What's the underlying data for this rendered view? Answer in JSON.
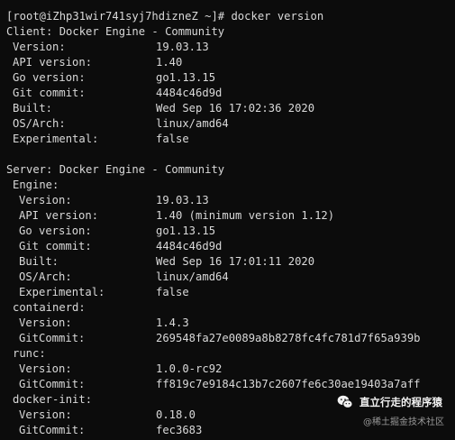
{
  "prompt": "[root@iZhp31wir741syj7hdizneZ ~]# docker version",
  "client": {
    "heading": "Client: Docker Engine - Community",
    "rows": [
      {
        "label": "Version:",
        "value": "19.03.13"
      },
      {
        "label": "API version:",
        "value": "1.40"
      },
      {
        "label": "Go version:",
        "value": "go1.13.15"
      },
      {
        "label": "Git commit:",
        "value": "4484c46d9d"
      },
      {
        "label": "Built:",
        "value": "Wed Sep 16 17:02:36 2020"
      },
      {
        "label": "OS/Arch:",
        "value": "linux/amd64"
      },
      {
        "label": "Experimental:",
        "value": "false"
      }
    ]
  },
  "server": {
    "heading": "Server: Docker Engine - Community",
    "engine": {
      "heading": "Engine:",
      "rows": [
        {
          "label": "Version:",
          "value": "19.03.13"
        },
        {
          "label": "API version:",
          "value": "1.40 (minimum version 1.12)"
        },
        {
          "label": "Go version:",
          "value": "go1.13.15"
        },
        {
          "label": "Git commit:",
          "value": "4484c46d9d"
        },
        {
          "label": "Built:",
          "value": "Wed Sep 16 17:01:11 2020"
        },
        {
          "label": "OS/Arch:",
          "value": "linux/amd64"
        },
        {
          "label": "Experimental:",
          "value": "false"
        }
      ]
    },
    "containerd": {
      "heading": "containerd:",
      "rows": [
        {
          "label": "Version:",
          "value": "1.4.3"
        },
        {
          "label": "GitCommit:",
          "value": "269548fa27e0089a8b8278fc4fc781d7f65a939b"
        }
      ]
    },
    "runc": {
      "heading": "runc:",
      "rows": [
        {
          "label": "Version:",
          "value": "1.0.0-rc92"
        },
        {
          "label": "GitCommit:",
          "value": "ff819c7e9184c13b7c2607fe6c30ae19403a7aff"
        }
      ]
    },
    "docker_init": {
      "heading": "docker-init:",
      "rows": [
        {
          "label": "Version:",
          "value": "0.18.0"
        },
        {
          "label": "GitCommit:",
          "value": "fec3683"
        }
      ]
    }
  },
  "watermark": {
    "title": "直立行走的程序猿",
    "subtitle": "@稀土掘金技术社区",
    "icon": "wechat-icon"
  },
  "colors": {
    "background": "#0c0c0c",
    "text": "#d9d9d9"
  }
}
